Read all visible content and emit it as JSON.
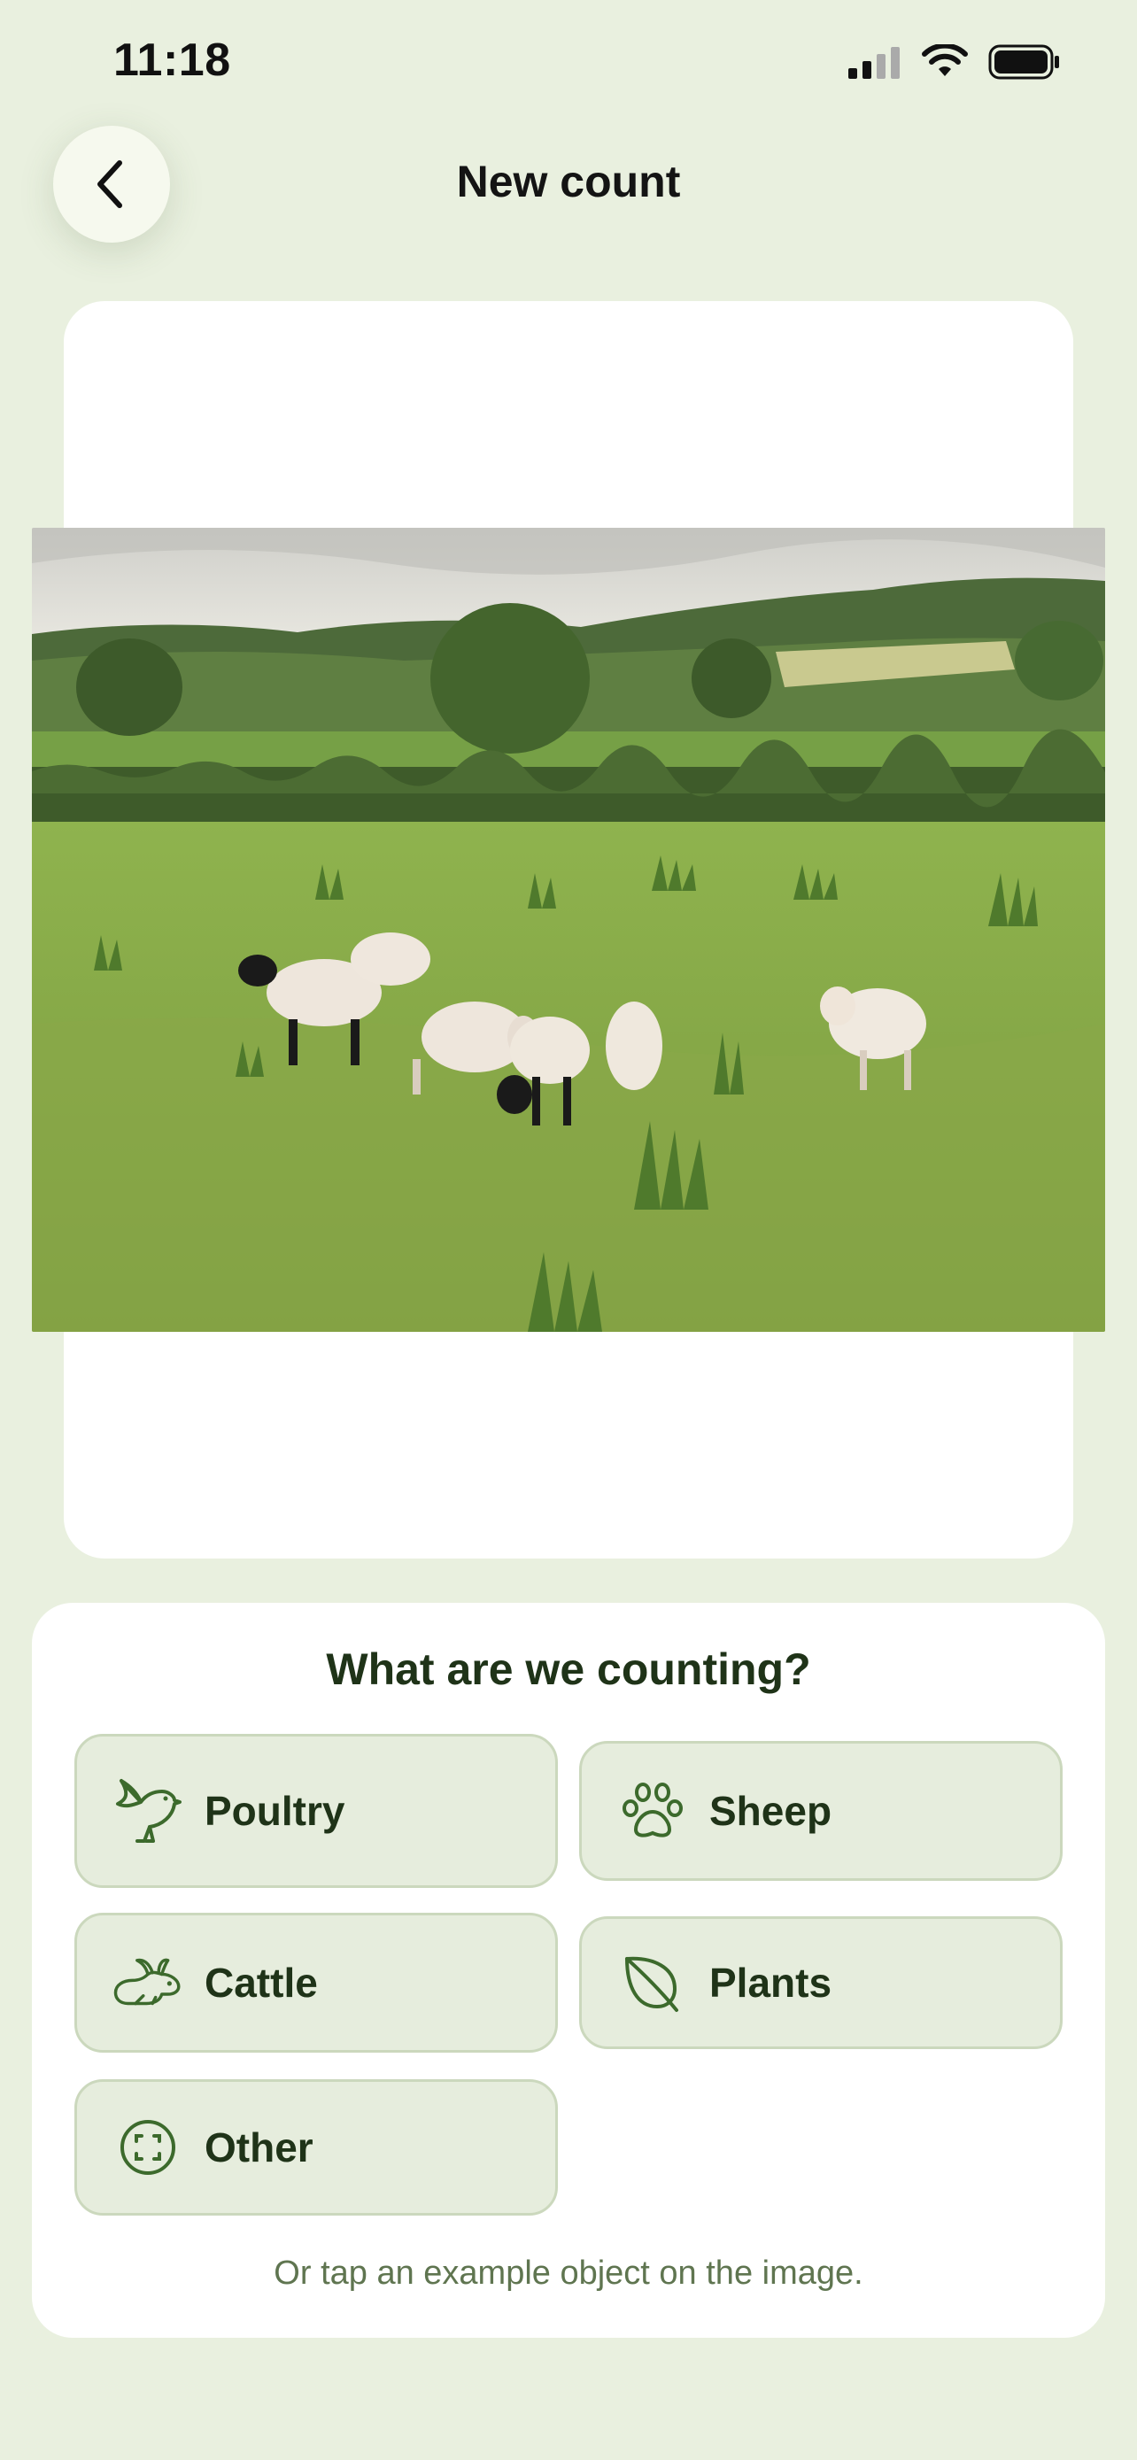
{
  "status_bar": {
    "time": "11:18"
  },
  "header": {
    "title": "New count",
    "back_icon": "chevron-left-icon"
  },
  "photo": {
    "description_icon": "photo"
  },
  "picker": {
    "title": "What are we counting?",
    "options": [
      {
        "label": "Poultry",
        "icon": "bird-icon"
      },
      {
        "label": "Sheep",
        "icon": "paw-icon"
      },
      {
        "label": "Cattle",
        "icon": "rabbit-icon"
      },
      {
        "label": "Plants",
        "icon": "leaf-icon"
      },
      {
        "label": "Other",
        "icon": "scan-icon"
      }
    ],
    "hint": "Or tap an example object on the image."
  },
  "colors": {
    "background": "#e9f0df",
    "accent": "#3c6a2c",
    "option_bg": "#e6eddd"
  }
}
